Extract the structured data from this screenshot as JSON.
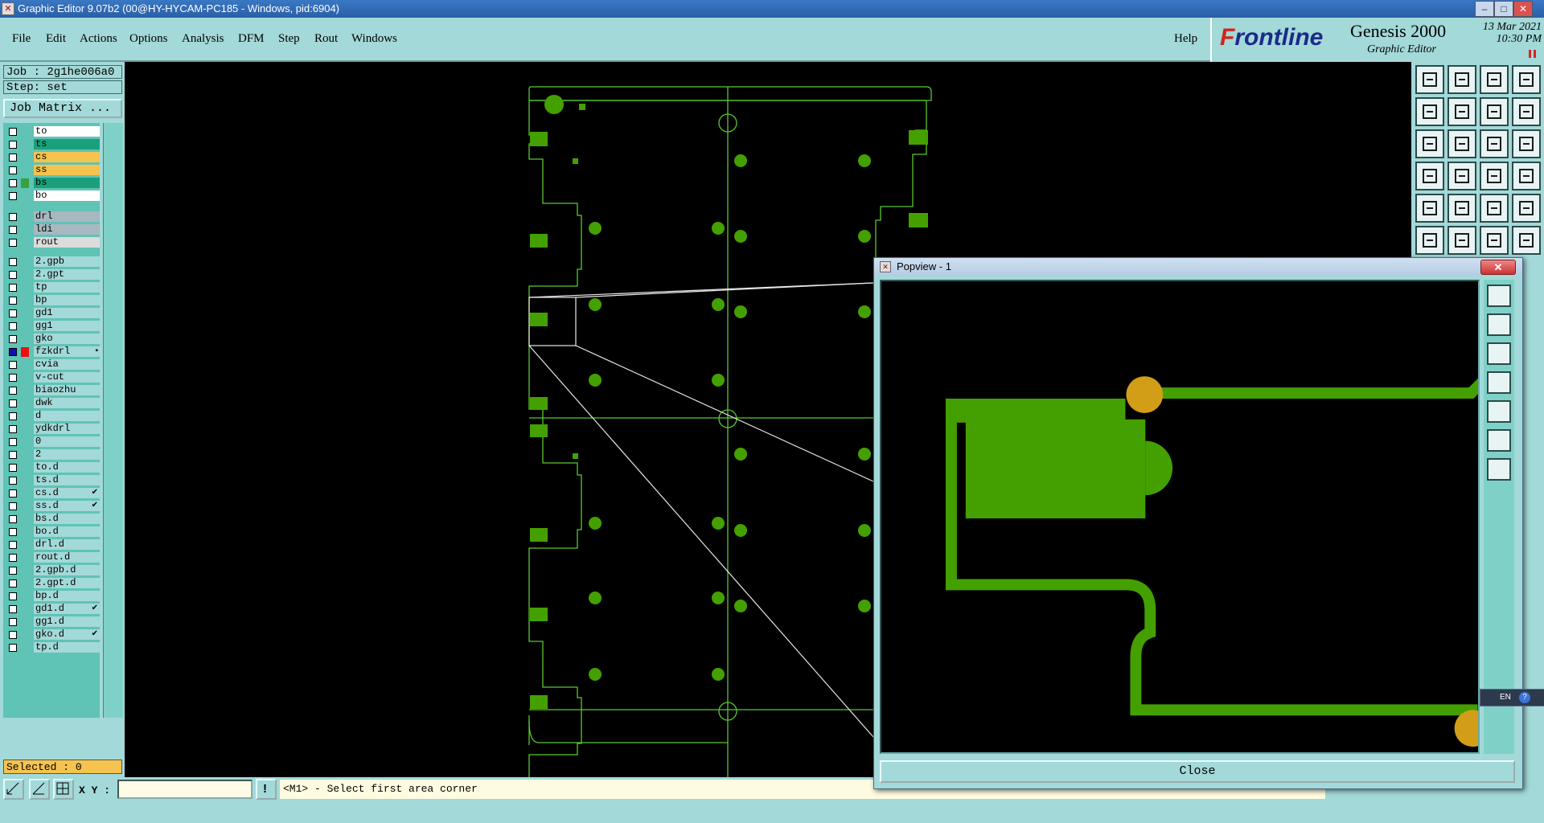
{
  "window": {
    "title": "Graphic Editor 9.07b2 (00@HY-HYCAM-PC185 - Windows, pid:6904)"
  },
  "menu": {
    "items": [
      "File",
      "Edit",
      "Actions",
      "Options",
      "Analysis",
      "DFM",
      "Step",
      "Rout",
      "Windows"
    ],
    "help": "Help"
  },
  "brand": {
    "logo_prefix": "F",
    "logo_rest": "rontline",
    "product": "Genesis 2000",
    "subtitle": "Graphic Editor",
    "date": "13 Mar 2021",
    "time": "10:30 PM"
  },
  "job": {
    "job_label": "Job : 2g1he006a0",
    "step_label": "Step: set",
    "matrix_button": "Job Matrix ..."
  },
  "layers": [
    {
      "name": "to",
      "color": "#ffffff",
      "mark": ""
    },
    {
      "name": "ts",
      "color": "#1aa07a",
      "mark": ""
    },
    {
      "name": "cs",
      "color": "#f5c34e",
      "mark": ""
    },
    {
      "name": "ss",
      "color": "#f5c34e",
      "mark": ""
    },
    {
      "name": "bs",
      "color": "#1aa07a",
      "mark": "",
      "swatch": "#3aa040"
    },
    {
      "name": "bo",
      "color": "#ffffff",
      "mark": ""
    },
    {
      "name": "drl",
      "color": "#a8b8c0",
      "mark": ""
    },
    {
      "name": "ldi",
      "color": "#a8b8c0",
      "mark": ""
    },
    {
      "name": "rout",
      "color": "#dcdcdc",
      "mark": ""
    },
    {
      "name": "2.gpb",
      "color": "#a3d9d8",
      "mark": ""
    },
    {
      "name": "2.gpt",
      "color": "#a3d9d8",
      "mark": ""
    },
    {
      "name": "tp",
      "color": "#a3d9d8",
      "mark": ""
    },
    {
      "name": "bp",
      "color": "#a3d9d8",
      "mark": ""
    },
    {
      "name": "gd1",
      "color": "#a3d9d8",
      "mark": ""
    },
    {
      "name": "gg1",
      "color": "#a3d9d8",
      "mark": ""
    },
    {
      "name": "gko",
      "color": "#a3d9d8",
      "mark": ""
    },
    {
      "name": "fzkdrl",
      "color": "#a3d9d8",
      "mark": "▪",
      "swatch": "#e81010",
      "active": true
    },
    {
      "name": "cvia",
      "color": "#a3d9d8",
      "mark": ""
    },
    {
      "name": "v-cut",
      "color": "#a3d9d8",
      "mark": ""
    },
    {
      "name": "biaozhu",
      "color": "#a3d9d8",
      "mark": ""
    },
    {
      "name": "dwk",
      "color": "#a3d9d8",
      "mark": ""
    },
    {
      "name": "d",
      "color": "#a3d9d8",
      "mark": ""
    },
    {
      "name": "ydkdrl",
      "color": "#a3d9d8",
      "mark": ""
    },
    {
      "name": "0",
      "color": "#a3d9d8",
      "mark": ""
    },
    {
      "name": "2",
      "color": "#a3d9d8",
      "mark": ""
    },
    {
      "name": "to.d",
      "color": "#a3d9d8",
      "mark": ""
    },
    {
      "name": "ts.d",
      "color": "#a3d9d8",
      "mark": ""
    },
    {
      "name": "cs.d",
      "color": "#a3d9d8",
      "mark": "✔"
    },
    {
      "name": "ss.d",
      "color": "#a3d9d8",
      "mark": "✔"
    },
    {
      "name": "bs.d",
      "color": "#a3d9d8",
      "mark": ""
    },
    {
      "name": "bo.d",
      "color": "#a3d9d8",
      "mark": ""
    },
    {
      "name": "drl.d",
      "color": "#a3d9d8",
      "mark": ""
    },
    {
      "name": "rout.d",
      "color": "#a3d9d8",
      "mark": ""
    },
    {
      "name": "2.gpb.d",
      "color": "#a3d9d8",
      "mark": ""
    },
    {
      "name": "2.gpt.d",
      "color": "#a3d9d8",
      "mark": ""
    },
    {
      "name": "bp.d",
      "color": "#a3d9d8",
      "mark": ""
    },
    {
      "name": "gd1.d",
      "color": "#a3d9d8",
      "mark": "✔"
    },
    {
      "name": "gg1.d",
      "color": "#a3d9d8",
      "mark": ""
    },
    {
      "name": "gko.d",
      "color": "#a3d9d8",
      "mark": "✔"
    },
    {
      "name": "tp.d",
      "color": "#a3d9d8",
      "mark": ""
    }
  ],
  "status": {
    "selected": "Selected : 0",
    "xy_label": "X Y :",
    "xy_value": "",
    "message": "<M1> - Select first area corner"
  },
  "popview": {
    "title": "Popview - 1",
    "close_label": "Close"
  },
  "ime": {
    "label": "EN"
  },
  "colors": {
    "panel": "#a3d9d8",
    "copper": "#44a000",
    "pad_gold": "#d39e17",
    "outline": "#5ac832"
  }
}
